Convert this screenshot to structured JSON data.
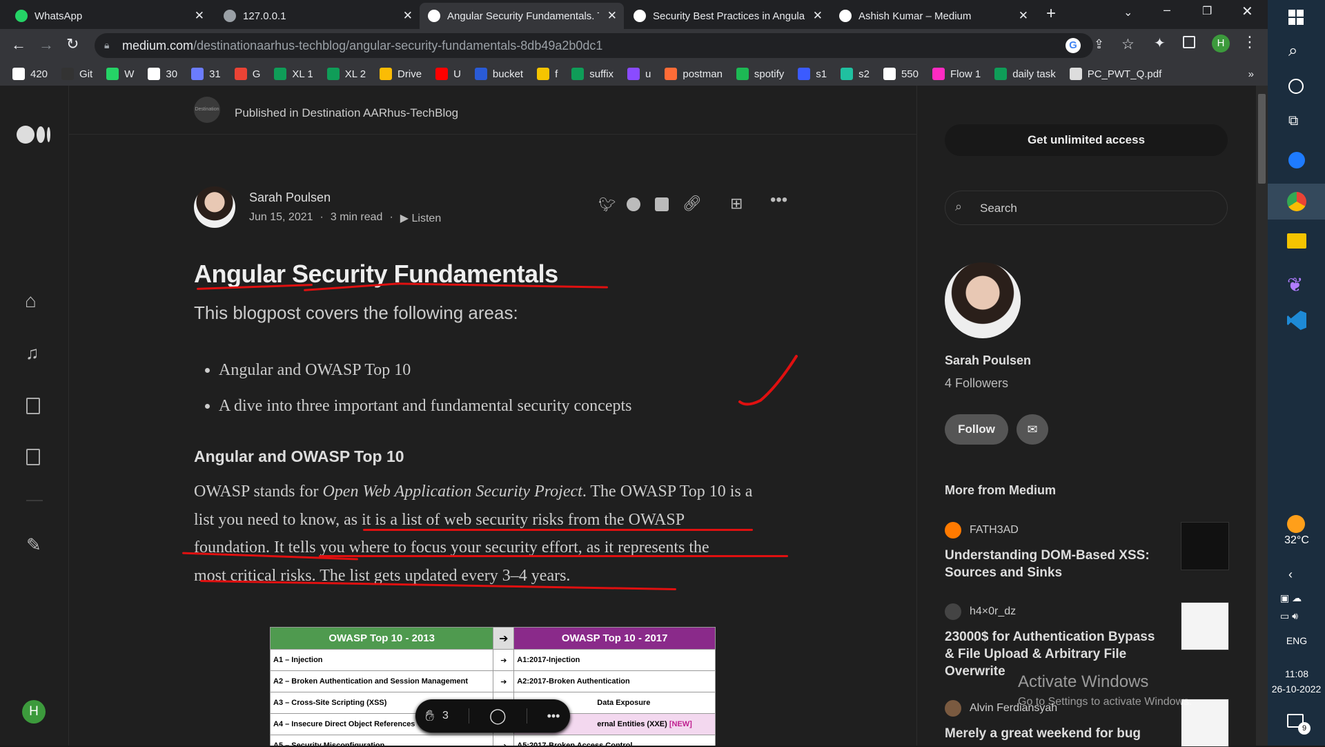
{
  "browser": {
    "tabs": [
      {
        "title": "WhatsApp",
        "active": false
      },
      {
        "title": "127.0.0.1",
        "active": false
      },
      {
        "title": "Angular Security Fundamentals. T",
        "active": true
      },
      {
        "title": "Security Best Practices in Angula",
        "active": false
      },
      {
        "title": "Ashish Kumar – Medium",
        "active": false
      }
    ],
    "url_domain": "medium.com",
    "url_path": "/destinationaarhus-techblog/angular-security-fundamentals-8db49a2b0dc1",
    "profile_initial": "H",
    "bookmarks": [
      {
        "label": "420",
        "color": "#ffffff"
      },
      {
        "label": "Git",
        "color": "#333333"
      },
      {
        "label": "W",
        "color": "#25d366"
      },
      {
        "label": "30",
        "color": "#ffffff"
      },
      {
        "label": "31",
        "color": "#6b7cff"
      },
      {
        "label": "G",
        "color": "#ea4335"
      },
      {
        "label": "XL 1",
        "color": "#0f9d58"
      },
      {
        "label": "XL 2",
        "color": "#0f9d58"
      },
      {
        "label": "Drive",
        "color": "#fbbc04"
      },
      {
        "label": "U",
        "color": "#ff0000"
      },
      {
        "label": "bucket",
        "color": "#2a5bd7"
      },
      {
        "label": "f",
        "color": "#f5c400"
      },
      {
        "label": "suffix",
        "color": "#0f9d58"
      },
      {
        "label": "u",
        "color": "#8a4bff"
      },
      {
        "label": "postman",
        "color": "#ff6c37"
      },
      {
        "label": "spotify",
        "color": "#1db954"
      },
      {
        "label": "s1",
        "color": "#3b5bff"
      },
      {
        "label": "s2",
        "color": "#20c0a0"
      },
      {
        "label": "550",
        "color": "#ffffff"
      },
      {
        "label": "Flow 1",
        "color": "#ff2bc2"
      },
      {
        "label": "daily task",
        "color": "#0f9d58"
      },
      {
        "label": "PC_PWT_Q.pdf",
        "color": "#dddddd"
      }
    ],
    "bookmarks_overflow": "»"
  },
  "leftnav": {
    "avatar_initial": "H"
  },
  "article": {
    "publication_logo": "Destination AARhus",
    "published_in": "Published in Destination AARhus-TechBlog",
    "author": "Sarah Poulsen",
    "date": "Jun 15, 2021",
    "read_time": "3 min read",
    "listen": "Listen",
    "title": "Angular Security Fundamentals",
    "subtitle": "This blogpost covers the following areas:",
    "bullets": [
      "Angular and OWASP Top 10",
      "A dive into three important and fundamental security concepts"
    ],
    "section_heading": "Angular and OWASP Top 10",
    "para_lines": [
      [
        "OWASP stands for ",
        "Open Web Application Security Project",
        ". The OWASP Top 10 is a"
      ],
      "list you need to know, as it is a list of web security risks from the OWASP",
      "foundation. It tells you where to focus your security effort, as it represents the",
      "most critical risks. The list gets updated every 3–4 years."
    ],
    "table": {
      "header_left": "OWASP Top 10 - 2013",
      "header_right": "OWASP Top 10 - 2017",
      "rows": [
        {
          "left": "A1 – Injection",
          "right": "A1:2017-Injection",
          "new": ""
        },
        {
          "left": "A2 – Broken Authentication and Session Management",
          "right": "A2:2017-Broken Authentication",
          "new": ""
        },
        {
          "left": "A3 – Cross-Site Scripting (XSS)",
          "right": "Data Exposure",
          "new": ""
        },
        {
          "left": "A4 – Insecure Direct Object References",
          "right": "ernal Entities (XXE)",
          "new": "[NEW]"
        },
        {
          "left": "A5 – Security Misconfiguration",
          "right": "A5:2017-Broken Access Control",
          "new": ""
        }
      ]
    },
    "claps": "3"
  },
  "sidebar": {
    "get_access": "Get unlimited access",
    "search_placeholder": "Search",
    "author_name": "Sarah Poulsen",
    "followers": "4 Followers",
    "follow": "Follow",
    "more_from": "More from Medium",
    "stories": [
      {
        "author": "FATH3AD",
        "title": "Understanding DOM-Based XSS: Sources and Sinks",
        "avatar_color": "#ff7a00"
      },
      {
        "author": "h4×0r_dz",
        "title": "23000$ for Authentication Bypass & File Upload & Arbitrary File Overwrite",
        "avatar_color": "#444444"
      },
      {
        "author": "Alvin Ferdiansyah",
        "title": "Merely a great weekend for bug",
        "avatar_color": "#7a5a40"
      }
    ]
  },
  "watermark": {
    "title": "Activate Windows",
    "subtitle": "Go to Settings to activate Windows."
  },
  "taskbar": {
    "temperature": "32°C",
    "language": "ENG",
    "time": "11:08",
    "date": "26-10-2022",
    "notifications": "9"
  }
}
